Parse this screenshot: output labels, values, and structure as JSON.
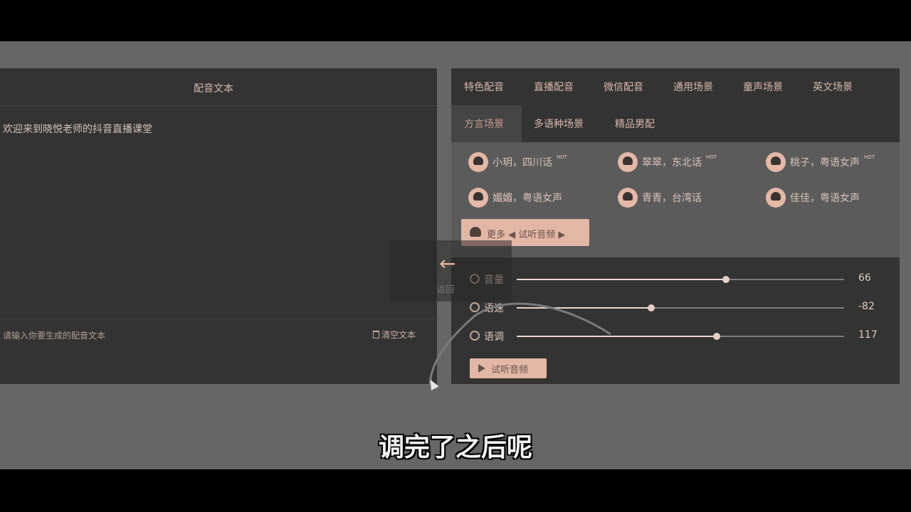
{
  "left_panel": {
    "title": "配音文本",
    "text": "欢迎来到晓悦老师的抖音直播课堂",
    "placeholder": "请输入你要生成的配音文本",
    "clear_label": "清空文本"
  },
  "right_panel": {
    "tabs_row1": [
      "特色配音",
      "直播配音",
      "微信配音",
      "通用场景",
      "童声场景",
      "英文场景"
    ],
    "tabs_row2": [
      "方言场景",
      "多语种场景",
      "精品男配"
    ],
    "active_tab": "方言场景",
    "voices": [
      {
        "name": "小玥，四川话",
        "badge": "HOT"
      },
      {
        "name": "翠翠，东北话",
        "badge": "HOT"
      },
      {
        "name": "桃子，粤语女声",
        "badge": "HOT"
      },
      {
        "name": "媚媚，粤语女声",
        "badge": ""
      },
      {
        "name": "青青，台湾话",
        "badge": ""
      },
      {
        "name": "佳佳，粤语女声",
        "badge": ""
      }
    ],
    "more_button": "更多   ◀ 试听音频 ▶",
    "sliders": [
      {
        "label": "音量",
        "value": "66",
        "fraction": 0.64,
        "icon": "volume-icon"
      },
      {
        "label": "语速",
        "value": "-82",
        "fraction": 0.41,
        "icon": "speed-icon"
      },
      {
        "label": "语调",
        "value": "117",
        "fraction": 0.61,
        "icon": "pitch-icon"
      }
    ],
    "play_button": "试听音频"
  },
  "overlay": {
    "tooltip_text": "返回",
    "subtitle": "调完了之后呢"
  },
  "colors": {
    "background": "#666666",
    "panel": "#333333",
    "accent": "#e3b7a6"
  }
}
